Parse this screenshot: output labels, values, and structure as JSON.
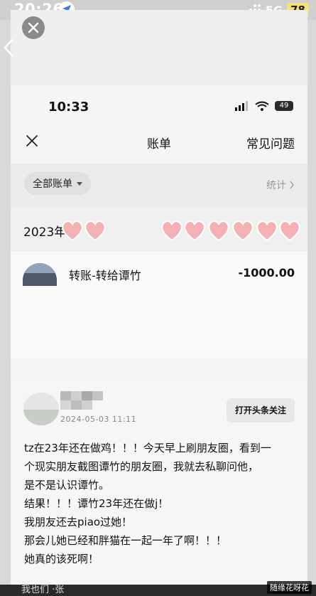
{
  "outer_status": {
    "time": "20:26",
    "network": "5G",
    "battery": "78"
  },
  "inner_status": {
    "time": "10:33",
    "battery": "49"
  },
  "nav": {
    "title": "账单",
    "help": "常见问题"
  },
  "filter": {
    "label": "全部账单",
    "stats": "统计"
  },
  "month": {
    "label": "2023年"
  },
  "transaction": {
    "title": "转账-转给谭竹",
    "amount": "-1000.00"
  },
  "post": {
    "date": "2024-05-03 11:11",
    "follow_label": "打开头条关注",
    "lines": [
      "tz在23年还在做鸡！！！今天早上刷朋友圈，看到一",
      "个现实朋友截图谭竹的朋友圈，我就去私聊问他，",
      "是不是认识谭竹。",
      "结果！！！谭竹23年还在做j！",
      "我朋友还去piao过她！",
      "那会儿她已经和胖猫在一起一年了啊！！！",
      "她真的该死啊！"
    ]
  },
  "bottom": {
    "text": "我也们 ·张"
  },
  "watermark": "随缘花呀花",
  "colors": {
    "heart": "#f4b1b5",
    "battery_badge": "#f7e27a"
  }
}
